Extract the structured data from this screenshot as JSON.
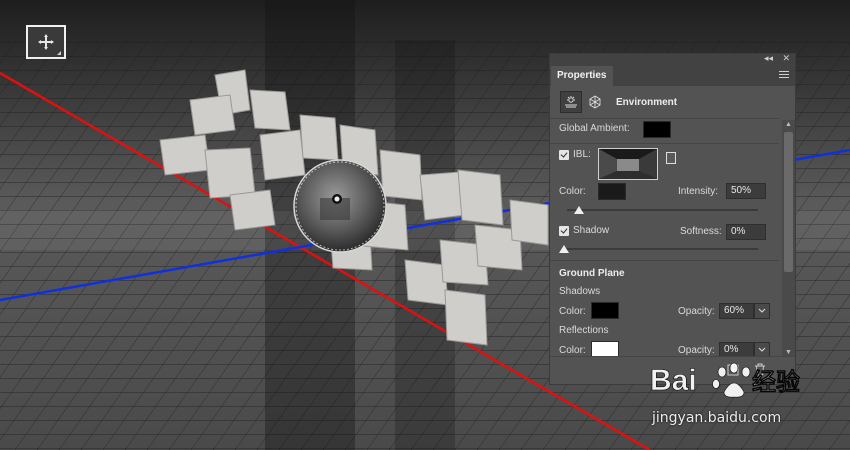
{
  "panel": {
    "tab_label": "Properties",
    "type_label": "Environment",
    "global_ambient_label": "Global Ambient:",
    "global_ambient_color": "#000000",
    "ibl": {
      "label": "IBL:",
      "checked": true,
      "color_label": "Color:",
      "color": "#1a1a1a",
      "intensity_label": "Intensity:",
      "intensity_value": "50%"
    },
    "shadow": {
      "label": "Shadow",
      "checked": true,
      "softness_label": "Softness:",
      "softness_value": "0%"
    },
    "ground_plane": {
      "heading": "Ground Plane",
      "shadows_heading": "Shadows",
      "shadows_color_label": "Color:",
      "shadows_color": "#000000",
      "shadows_opacity_label": "Opacity:",
      "shadows_opacity_value": "60%",
      "reflections_heading": "Reflections",
      "reflections_color_label": "Color:",
      "reflections_color": "#ffffff",
      "reflections_opacity_label": "Opacity:",
      "reflections_opacity_value": "0%"
    }
  },
  "watermark": {
    "brand_left": "Bai",
    "brand_right": "经验",
    "url": "jingyan.baidu.com"
  },
  "colors": {
    "axis_x": "#e01010",
    "axis_z": "#1030e0",
    "ground": "#3a3a3a"
  },
  "icons": [
    "move-icon",
    "environment-icon",
    "3d-mesh-icon",
    "panel-menu-icon",
    "collapse-icon",
    "close-icon",
    "new-icon",
    "trash-icon",
    "file-icon",
    "chevron-down-icon"
  ]
}
